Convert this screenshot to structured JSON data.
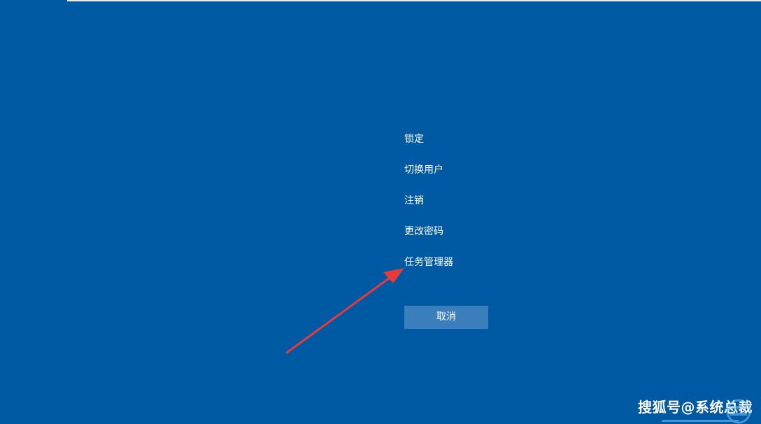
{
  "screen": {
    "background_color": "#0059a3",
    "accent_button_color": "#3a7fbc",
    "annotation_color": "#e83a3a"
  },
  "menu": {
    "items": [
      {
        "label": "锁定"
      },
      {
        "label": "切换用户"
      },
      {
        "label": "注销"
      },
      {
        "label": "更改密码"
      },
      {
        "label": "任务管理器"
      }
    ]
  },
  "cancel_button": {
    "label": "取消"
  },
  "watermark": {
    "text": "搜狐号@系统总裁",
    "logo_icon": "watermark-logo-icon"
  },
  "annotation": {
    "icon": "red-arrow-icon",
    "points_to": "任务管理器"
  }
}
